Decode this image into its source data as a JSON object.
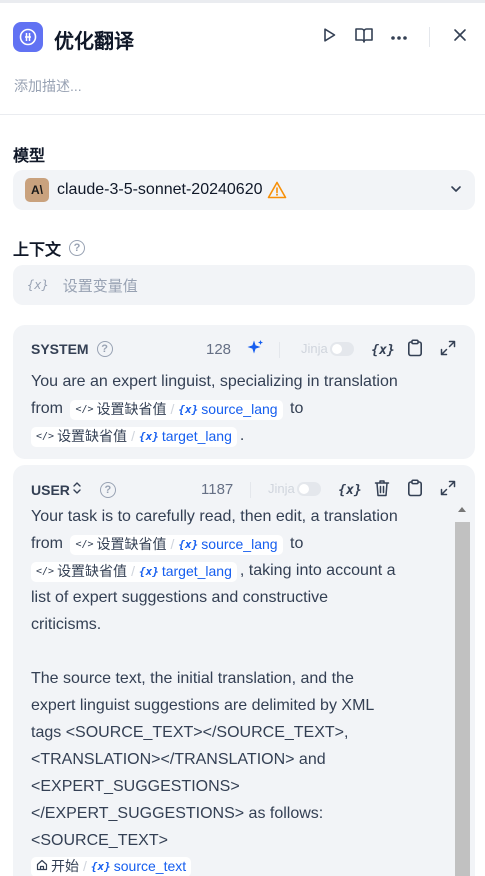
{
  "header": {
    "title": "优化翻译",
    "description_placeholder": "添加描述..."
  },
  "model": {
    "label": "模型",
    "name": "claude-3-5-sonnet-20240620",
    "logo_text": "A\\"
  },
  "context": {
    "label": "上下文",
    "placeholder": "设置变量值"
  },
  "system_prompt": {
    "role": "SYSTEM",
    "token_count": "128",
    "jinja_label": "Jinja",
    "lines": {
      "l1": "You are an expert linguist, specializing in translation",
      "l2_pre": "from",
      "l2_post": "to",
      "l3_post": "."
    },
    "var1": {
      "default_label": "设置缺省值",
      "var_name": "source_lang"
    },
    "var2": {
      "default_label": "设置缺省值",
      "var_name": "target_lang"
    }
  },
  "user_prompt": {
    "role": "USER",
    "token_count": "1187",
    "jinja_label": "Jinja",
    "lines": {
      "l1": "Your task is to carefully read, then edit, a translation",
      "l2_pre": "from",
      "l2_post": "to",
      "l3_post": ", taking into account a",
      "l4": "list of expert suggestions and constructive",
      "l5": "criticisms.",
      "l6": "The source text, the initial translation, and the",
      "l7": "expert linguist suggestions are delimited by XML",
      "l8": "tags <SOURCE_TEXT></SOURCE_TEXT>,",
      "l9": "<TRANSLATION></TRANSLATION> and",
      "l10": "<EXPERT_SUGGESTIONS>",
      "l11": "</EXPERT_SUGGESTIONS> as follows:",
      "l12": "<SOURCE_TEXT>"
    },
    "var1": {
      "default_label": "设置缺省值",
      "var_name": "source_lang"
    },
    "var2": {
      "default_label": "设置缺省值",
      "var_name": "target_lang"
    },
    "var3": {
      "node_label": "开始",
      "var_name": "source_text"
    }
  },
  "icons": {
    "var_glyph": "{x}",
    "code_glyph": "</>",
    "help_glyph": "?"
  },
  "colors": {
    "accent": "#155eef",
    "app_icon": "#6172f3",
    "warning": "#f79009"
  }
}
